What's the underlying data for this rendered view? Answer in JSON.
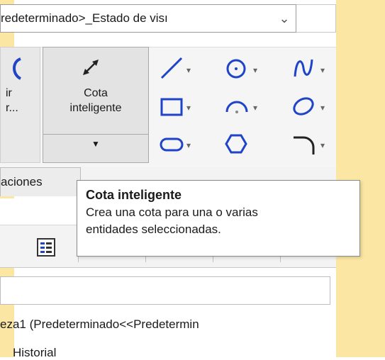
{
  "config_combo": {
    "value": "redeterminado>_Estado de visı"
  },
  "ribbon": {
    "left_button": {
      "label_line1": "ir",
      "label_line2": "r..."
    },
    "smart_dimension": {
      "label_line1": "Cota",
      "label_line2": "inteligente"
    }
  },
  "tabs": [
    {
      "label": "aciones"
    }
  ],
  "tooltip": {
    "title": "Cota inteligente",
    "line1": "Crea una cota para una o varias",
    "line2": "entidades seleccionadas."
  },
  "tree": {
    "part": "eza1  (Predeterminado<<Predetermin",
    "history": "Historial"
  },
  "colors": {
    "frame": "#fbe7a3",
    "icon_blue": "#1f44c8"
  }
}
